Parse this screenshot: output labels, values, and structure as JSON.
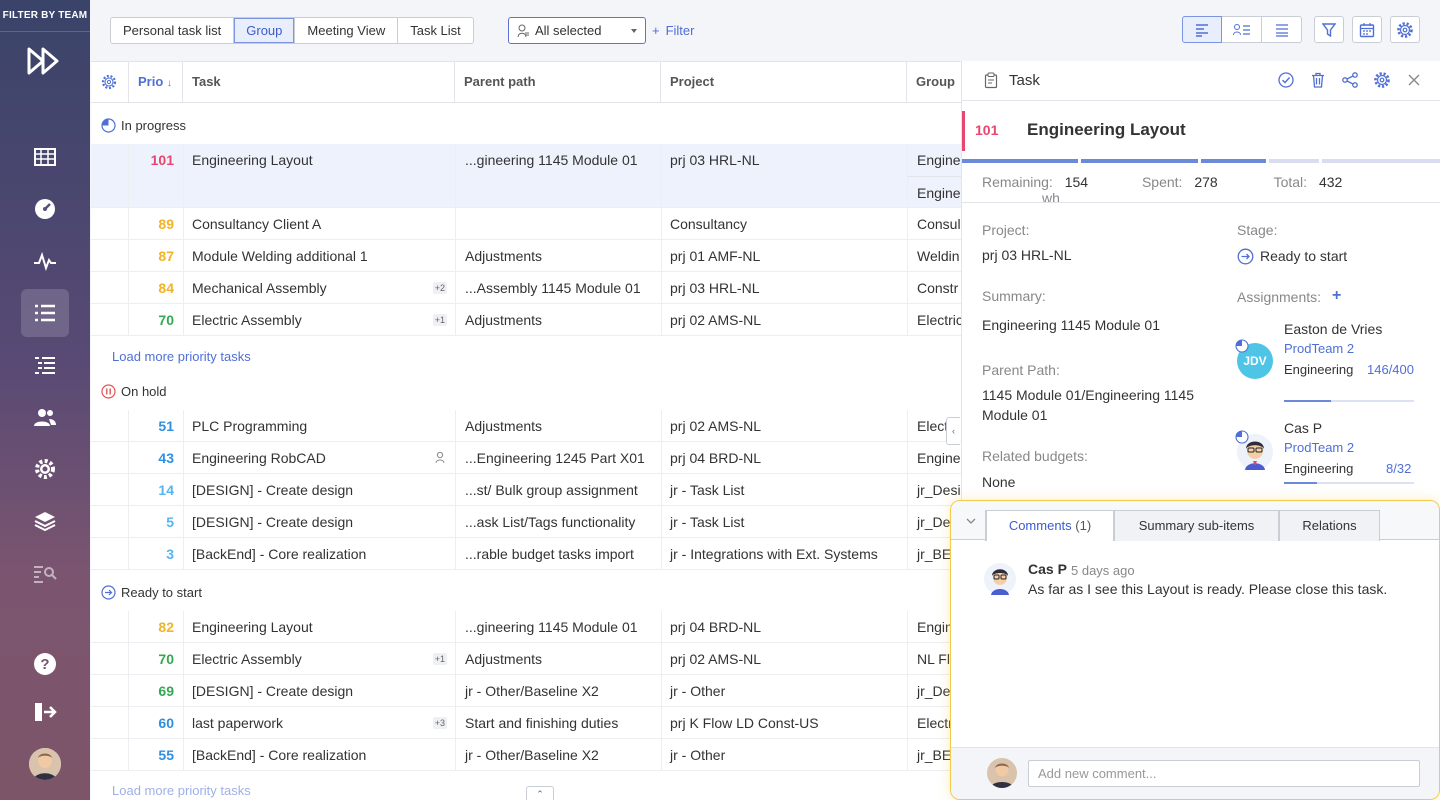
{
  "sidebar": {
    "brand": "FILTER BY TEAM",
    "items": [
      "grid-icon",
      "dashboard-icon",
      "pulse-icon",
      "list-icon",
      "priority-list-icon",
      "users-icon",
      "settings-icon",
      "layers-icon",
      "analytics-icon",
      "help-icon",
      "logout-icon"
    ],
    "active": "list-icon"
  },
  "toolbar": {
    "views": [
      "Personal task list",
      "Group",
      "Meeting View",
      "Task List"
    ],
    "active_view": "Group",
    "team_select": "All selected",
    "filter": "Filter"
  },
  "table": {
    "columns": {
      "prio": "Prio",
      "task": "Task",
      "parent": "Parent path",
      "project": "Project",
      "group": "Group"
    },
    "groups": [
      {
        "label": "In progress",
        "icon": "in-progress-icon",
        "rows": [
          {
            "prio": "101",
            "color": "#e8466e",
            "task": "Engineering Layout",
            "badge": "",
            "parent": "...gineering 1145 Module 01",
            "project": "prj 03 HRL-NL",
            "group": "Engine",
            "group2": "Engine"
          },
          {
            "prio": "89",
            "color": "#f0b429",
            "task": "Consultancy Client A",
            "badge": "",
            "parent": "",
            "project": "Consultancy",
            "group": "Consul"
          },
          {
            "prio": "87",
            "color": "#f0b429",
            "task": "Module Welding additional 1",
            "badge": "",
            "parent": "Adjustments",
            "project": "prj 01 AMF-NL",
            "group": "Weldin"
          },
          {
            "prio": "84",
            "color": "#f0b429",
            "task": "Mechanical Assembly",
            "badge": "+2",
            "parent": "...Assembly 1145 Module 01",
            "project": "prj 03 HRL-NL",
            "group": "Constr"
          },
          {
            "prio": "70",
            "color": "#34a852",
            "task": "Electric Assembly",
            "badge": "+1",
            "parent": "Adjustments",
            "project": "prj 02 AMS-NL",
            "group": "Electric"
          }
        ]
      },
      {
        "label": "On hold",
        "icon": "on-hold-icon",
        "rows": [
          {
            "prio": "51",
            "color": "#2f8fe0",
            "task": "PLC Programming",
            "badge": "",
            "parent": "Adjustments",
            "project": "prj 02 AMS-NL",
            "group": "Electr"
          },
          {
            "prio": "43",
            "color": "#2f8fe0",
            "task": "Engineering RobCAD",
            "badge": "$",
            "parent": "...Engineering 1245 Part X01",
            "project": "prj 04 BRD-NL",
            "group": "Engine"
          },
          {
            "prio": "14",
            "color": "#56b4ef",
            "task": "[DESIGN] - Create design",
            "badge": "",
            "parent": "...st/ Bulk group assignment",
            "project": "jr - Task List",
            "group": "jr_Desi"
          },
          {
            "prio": "5",
            "color": "#56b4ef",
            "task": "[DESIGN] - Create design",
            "badge": "",
            "parent": "...ask List/Tags functionality",
            "project": "jr - Task List",
            "group": "jr_Desi"
          },
          {
            "prio": "3",
            "color": "#56b4ef",
            "task": "[BackEnd] - Core realization",
            "badge": "",
            "parent": "...rable budget tasks import",
            "project": "jr - Integrations with Ext. Systems",
            "group": "jr_BE"
          }
        ]
      },
      {
        "label": "Ready to start",
        "icon": "ready-icon",
        "rows": [
          {
            "prio": "82",
            "color": "#f0b429",
            "task": "Engineering Layout",
            "badge": "",
            "parent": "...gineering 1145 Module 01",
            "project": "prj 04 BRD-NL",
            "group": "Engine"
          },
          {
            "prio": "70",
            "color": "#34a852",
            "task": "Electric Assembly",
            "badge": "+1",
            "parent": "Adjustments",
            "project": "prj 02 AMS-NL",
            "group": "NL Floo"
          },
          {
            "prio": "69",
            "color": "#34a852",
            "task": "[DESIGN] - Create design",
            "badge": "",
            "parent": "jr - Other/Baseline X2",
            "project": "jr - Other",
            "group": "jr_Desi"
          },
          {
            "prio": "60",
            "color": "#2f8fe0",
            "task": "last paperwork",
            "badge": "+3",
            "parent": "Start and finishing duties",
            "project": "prj K Flow LD Const-US",
            "group": "Electric"
          },
          {
            "prio": "55",
            "color": "#2f8fe0",
            "task": "[BackEnd] - Core realization",
            "badge": "",
            "parent": "jr - Other/Baseline X2",
            "project": "jr - Other",
            "group": "jr_BE"
          }
        ]
      }
    ],
    "load_more": "Load more priority tasks"
  },
  "panel": {
    "title": "Task",
    "task_number": "101",
    "task_name": "Engineering Layout",
    "remaining_label": "Remaining:",
    "remaining": "154",
    "spent_label": "Spent:",
    "spent": "278",
    "total_label": "Total:",
    "total": "432",
    "unit": "wh",
    "project_label": "Project:",
    "project": "prj 03 HRL-NL",
    "stage_label": "Stage:",
    "stage": "Ready to start",
    "summary_label": "Summary:",
    "summary": "Engineering 1145 Module 01",
    "assignments_label": "Assignments:",
    "parent_label": "Parent Path:",
    "parent_path": "1145 Module 01/Engineering 1145 Module 01",
    "budgets_label": "Related budgets:",
    "budgets": "None",
    "assignments": [
      {
        "name": "Easton de Vries",
        "initials": "JDV",
        "team": "ProdTeam 2",
        "role": "Engineering",
        "ratio": "146/400",
        "progress": 0.365
      },
      {
        "name": "Cas P",
        "initials": "",
        "team": "ProdTeam 2",
        "role": "Engineering",
        "ratio": "8/32",
        "progress": 0.25
      }
    ]
  },
  "comments": {
    "tabs": [
      {
        "label": "Comments",
        "count": "(1)"
      },
      {
        "label": "Summary sub-items"
      },
      {
        "label": "Relations"
      }
    ],
    "items": [
      {
        "author": "Cas P",
        "time": "5 days ago",
        "text": "As far as I see this Layout is ready. Please close this task."
      }
    ],
    "placeholder": "Add new comment..."
  },
  "colors": {
    "accent": "#4f6fd6",
    "highlight": "#f2c94c",
    "red": "#e8466e",
    "yellow": "#f0b429",
    "green": "#34a852",
    "blue": "#2f8fe0"
  }
}
